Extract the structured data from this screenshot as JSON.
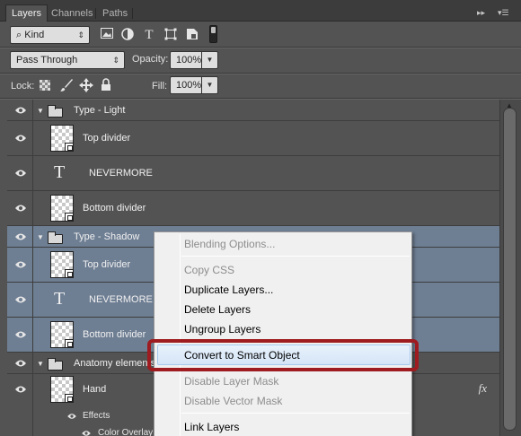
{
  "tabs": {
    "layers": "Layers",
    "channels": "Channels",
    "paths": "Paths",
    "collapse_glyph": "▸▸",
    "menu_glyph": "▾☰"
  },
  "filter": {
    "kind_label": "Kind",
    "kind_glyph": "⌕",
    "icons": [
      "image-filter-icon",
      "adjustment-filter-icon",
      "type-filter-icon",
      "shape-filter-icon",
      "smart-object-filter-icon",
      "filter-toggle-icon"
    ]
  },
  "blend": {
    "mode": "Pass Through",
    "opacity_label": "Opacity:",
    "opacity_value": "100%"
  },
  "lock": {
    "label": "Lock:",
    "fill_label": "Fill:",
    "fill_value": "100%"
  },
  "layers": [
    {
      "type": "group",
      "name": "Type - Light",
      "selected": false
    },
    {
      "type": "pixel",
      "name": "Top divider",
      "selected": false
    },
    {
      "type": "text",
      "name": "NEVERMORE",
      "selected": false
    },
    {
      "type": "pixel",
      "name": "Bottom divider",
      "selected": false
    },
    {
      "type": "group",
      "name": "Type - Shadow",
      "selected": true
    },
    {
      "type": "pixel",
      "name": "Top divider",
      "selected": true
    },
    {
      "type": "text",
      "name": "NEVERMORE",
      "selected": true
    },
    {
      "type": "pixel",
      "name": "Bottom divider",
      "selected": true
    },
    {
      "type": "group",
      "name": "Anatomy elements",
      "selected": false
    },
    {
      "type": "pixel",
      "name": "Hand",
      "selected": false,
      "fx": "fx"
    }
  ],
  "effects": {
    "label": "Effects",
    "items": [
      "Color Overlay"
    ]
  },
  "context_menu": {
    "items": [
      {
        "label": "Blending Options...",
        "disabled": true
      },
      {
        "label": "Copy CSS",
        "disabled": true
      },
      {
        "label": "Duplicate Layers...",
        "disabled": false
      },
      {
        "label": "Delete Layers",
        "disabled": false
      },
      {
        "label": "Ungroup Layers",
        "disabled": false
      },
      {
        "label": "Convert to Smart Object",
        "disabled": false,
        "highlighted": true
      },
      {
        "label": "Disable Layer Mask",
        "disabled": true
      },
      {
        "label": "Disable Vector Mask",
        "disabled": true
      },
      {
        "label": "Link Layers",
        "disabled": false
      }
    ]
  },
  "colors": {
    "panel_bg": "#535353",
    "selection_bg": "#6e7e93",
    "menu_highlight": "#d5e5f7",
    "callout_red": "#9e1b1f"
  }
}
